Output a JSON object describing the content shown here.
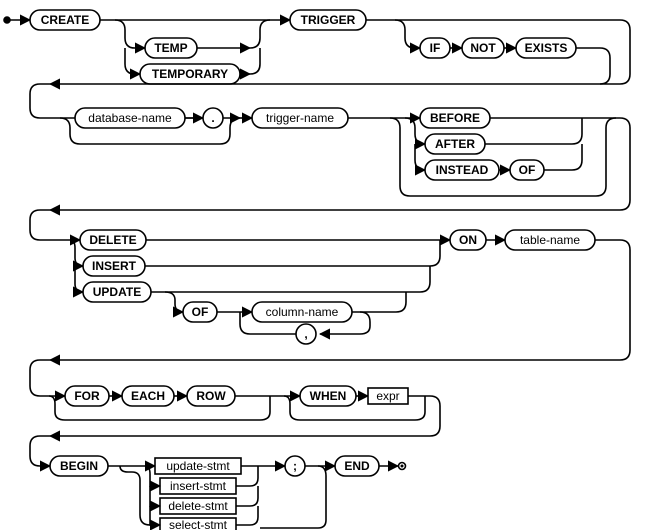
{
  "diagram": {
    "name": "create-trigger-stmt",
    "type": "railroad",
    "tokens": {
      "CREATE": "CREATE",
      "TEMP": "TEMP",
      "TEMPORARY": "TEMPORARY",
      "TRIGGER": "TRIGGER",
      "IF": "IF",
      "NOT": "NOT",
      "EXISTS": "EXISTS",
      "database_name": "database-name",
      "DOT": ".",
      "trigger_name": "trigger-name",
      "BEFORE": "BEFORE",
      "AFTER": "AFTER",
      "INSTEAD": "INSTEAD",
      "OF": "OF",
      "DELETE": "DELETE",
      "INSERT": "INSERT",
      "UPDATE": "UPDATE",
      "OF2": "OF",
      "column_name": "column-name",
      "COMMA": ",",
      "ON": "ON",
      "table_name": "table-name",
      "FOR": "FOR",
      "EACH": "EACH",
      "ROW": "ROW",
      "WHEN": "WHEN",
      "expr": "expr",
      "BEGIN": "BEGIN",
      "update_stmt": "update-stmt",
      "insert_stmt": "insert-stmt",
      "delete_stmt": "delete-stmt",
      "select_stmt": "select-stmt",
      "SEMI": ";",
      "END": "END"
    }
  },
  "chart_data": {
    "type": "railroad-diagram",
    "title": "",
    "grammar": "CREATE [TEMP|TEMPORARY] TRIGGER [IF NOT EXISTS] [database-name .] trigger-name [BEFORE|AFTER|INSTEAD OF] (DELETE|INSERT|UPDATE [OF column-name {, column-name}]) ON table-name [FOR EACH ROW] [WHEN expr] BEGIN (update-stmt|insert-stmt|delete-stmt|select-stmt) ; { (update-stmt|insert-stmt|delete-stmt|select-stmt) ; } END",
    "nodes": [
      {
        "id": "CREATE",
        "kind": "keyword"
      },
      {
        "id": "TEMP",
        "kind": "keyword",
        "optional_group": "temp"
      },
      {
        "id": "TEMPORARY",
        "kind": "keyword",
        "optional_group": "temp"
      },
      {
        "id": "TRIGGER",
        "kind": "keyword"
      },
      {
        "id": "IF",
        "kind": "keyword",
        "optional_group": "ifnotexists"
      },
      {
        "id": "NOT",
        "kind": "keyword",
        "optional_group": "ifnotexists"
      },
      {
        "id": "EXISTS",
        "kind": "keyword",
        "optional_group": "ifnotexists"
      },
      {
        "id": "database-name",
        "kind": "rule",
        "optional_group": "dbname"
      },
      {
        "id": ".",
        "kind": "keyword",
        "optional_group": "dbname"
      },
      {
        "id": "trigger-name",
        "kind": "rule"
      },
      {
        "id": "BEFORE",
        "kind": "keyword",
        "optional_group": "timing"
      },
      {
        "id": "AFTER",
        "kind": "keyword",
        "optional_group": "timing"
      },
      {
        "id": "INSTEAD",
        "kind": "keyword",
        "optional_group": "timing"
      },
      {
        "id": "OF",
        "kind": "keyword",
        "optional_group": "timing"
      },
      {
        "id": "DELETE",
        "kind": "keyword",
        "alt_group": "event"
      },
      {
        "id": "INSERT",
        "kind": "keyword",
        "alt_group": "event"
      },
      {
        "id": "UPDATE",
        "kind": "keyword",
        "alt_group": "event"
      },
      {
        "id": "OF",
        "kind": "keyword",
        "optional_group": "update_of"
      },
      {
        "id": "column-name",
        "kind": "rule",
        "repeat": ",",
        "optional_group": "update_of"
      },
      {
        "id": "ON",
        "kind": "keyword"
      },
      {
        "id": "table-name",
        "kind": "rule"
      },
      {
        "id": "FOR",
        "kind": "keyword",
        "optional_group": "foreachrow"
      },
      {
        "id": "EACH",
        "kind": "keyword",
        "optional_group": "foreachrow"
      },
      {
        "id": "ROW",
        "kind": "keyword",
        "optional_group": "foreachrow"
      },
      {
        "id": "WHEN",
        "kind": "keyword",
        "optional_group": "when"
      },
      {
        "id": "expr",
        "kind": "rule-ref",
        "optional_group": "when"
      },
      {
        "id": "BEGIN",
        "kind": "keyword"
      },
      {
        "id": "update-stmt",
        "kind": "rule-ref",
        "alt_group": "body",
        "repeat": ";"
      },
      {
        "id": "insert-stmt",
        "kind": "rule-ref",
        "alt_group": "body"
      },
      {
        "id": "delete-stmt",
        "kind": "rule-ref",
        "alt_group": "body"
      },
      {
        "id": "select-stmt",
        "kind": "rule-ref",
        "alt_group": "body"
      },
      {
        "id": ";",
        "kind": "keyword"
      },
      {
        "id": "END",
        "kind": "keyword"
      }
    ]
  }
}
